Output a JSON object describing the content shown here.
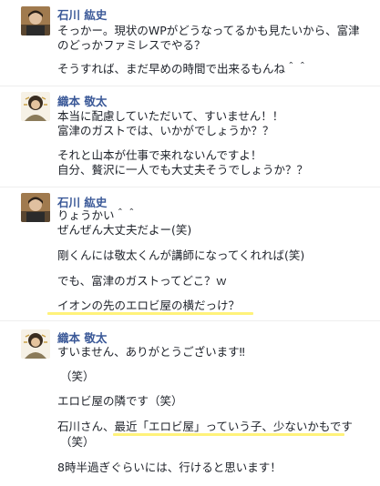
{
  "messages": [
    {
      "sender": "石川 紘史",
      "lines": [
        "そっかー。現状のWPがどうなってるかも見たいから、富津",
        "のどっかファミレスでやる？",
        "そうすれば、まだ早めの時間で出来るもんね＾＾"
      ]
    },
    {
      "sender": "織本 敬太",
      "lines": [
        "本当に配慮していただいて、すいません！！",
        "富津のガストでは、いかがでしょうか？？",
        "それと山本が仕事で来れないんですよ！",
        "自分、贅沢に一人でも大丈夫そうでしょうか？？"
      ]
    },
    {
      "sender": "石川 紘史",
      "lines": [
        "りょうかい＾＾",
        "ぜんぜん大丈夫だよー(笑)",
        "剛くんには敬太くんが講師になってくれれば(笑)",
        "でも、富津のガストってどこ？ｗ",
        "イオンの先のエロビ屋の横だっけ？"
      ]
    },
    {
      "sender": "織本 敬太",
      "lines": [
        "すいません、ありがとうございます‼",
        "（笑）",
        "エロビ屋の隣です（笑）",
        "石川さん、最近「エロビ屋」っていう子、少ないかもです",
        "（笑）",
        "8時半過ぎぐらいには、行けると思います！"
      ]
    }
  ],
  "colors": {
    "name": "#3b5998",
    "text": "#1d2129",
    "highlight": "#fff27a"
  },
  "icons": {
    "avatar_ishikawa": "profile-photo",
    "avatar_orimoto": "profile-photo"
  }
}
